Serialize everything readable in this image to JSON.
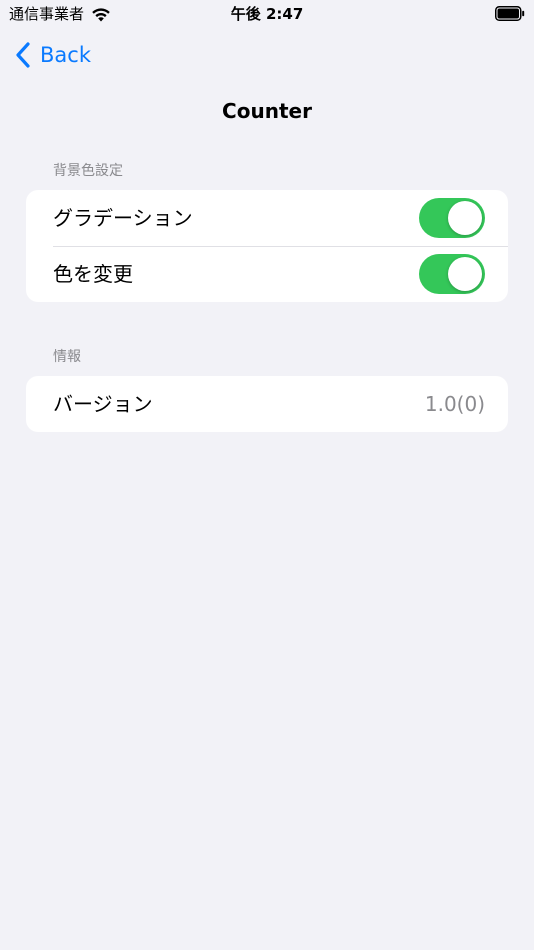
{
  "status_bar": {
    "carrier": "通信事業者",
    "time": "午後 2:47"
  },
  "nav": {
    "back_label": "Back",
    "title": "Counter"
  },
  "sections": [
    {
      "header": "背景色設定",
      "rows": [
        {
          "label": "グラデーション",
          "toggle": true
        },
        {
          "label": "色を変更",
          "toggle": true
        }
      ]
    },
    {
      "header": "情報",
      "rows": [
        {
          "label": "バージョン",
          "value": "1.0(0)"
        }
      ]
    }
  ],
  "colors": {
    "accent": "#0a7aff",
    "toggle_on": "#34c759",
    "background": "#f2f2f7",
    "secondary_text": "#8a8a8e"
  }
}
